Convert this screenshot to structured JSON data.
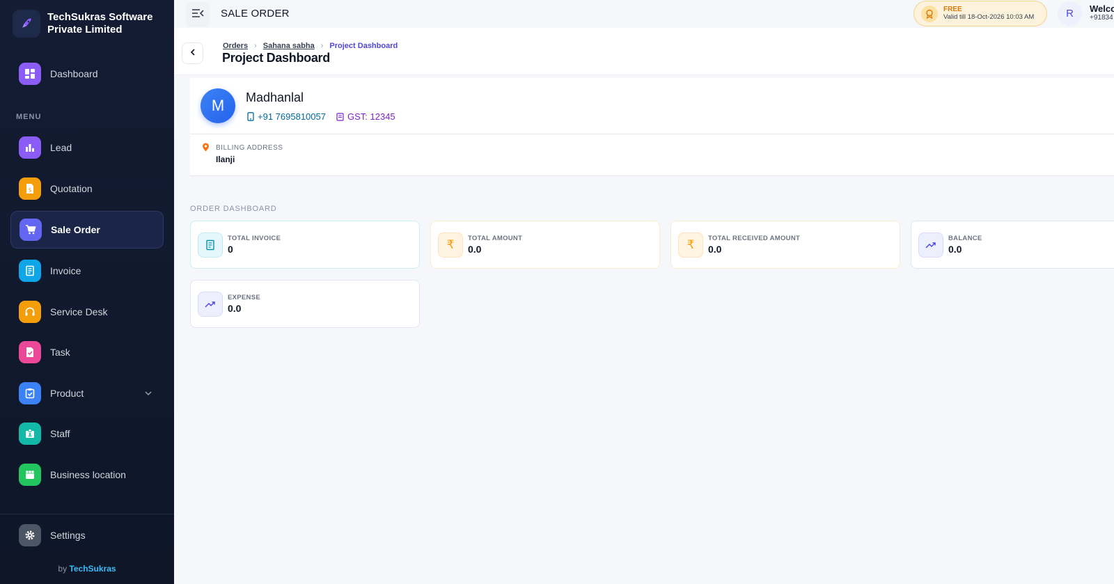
{
  "brand": {
    "name": "TechSukras Software Private Limited"
  },
  "sidebar": {
    "dashboard_label": "Dashboard",
    "menu_caption": "MENU",
    "items": [
      {
        "label": "Lead",
        "icon": "bar-chart-icon",
        "color": "#8b5cf6"
      },
      {
        "label": "Quotation",
        "icon": "quotation-doc-icon",
        "color": "#f59e0b"
      },
      {
        "label": "Sale Order",
        "icon": "cart-icon",
        "color": "#6366f1",
        "active": true
      },
      {
        "label": "Invoice",
        "icon": "receipt-icon",
        "color": "#0ea5e9"
      },
      {
        "label": "Service Desk",
        "icon": "headset-icon",
        "color": "#f59e0b"
      },
      {
        "label": "Task",
        "icon": "task-icon",
        "color": "#ec4899"
      },
      {
        "label": "Product",
        "icon": "clipboard-icon",
        "color": "#3b82f6",
        "has_submenu": true
      },
      {
        "label": "Staff",
        "icon": "id-badge-icon",
        "color": "#14b8a6"
      },
      {
        "label": "Business location",
        "icon": "store-icon",
        "color": "#22c55e"
      }
    ],
    "settings_label": "Settings",
    "byline_prefix": "by",
    "byline_brand": "TechSukras"
  },
  "topbar": {
    "page_heading": "SALE ORDER",
    "plan_title": "FREE",
    "plan_valid": "Valid till 18-Oct-2026 10:03 AM",
    "avatar_letter": "R",
    "welcome_title": "Welco",
    "welcome_sub": "+91834"
  },
  "breadcrumb": {
    "items": [
      "Orders",
      "Sahana sabha"
    ],
    "current": "Project Dashboard"
  },
  "page_title": "Project Dashboard",
  "customer": {
    "initial": "M",
    "name": "Madhanlal",
    "phone": "+91 7695810057",
    "gst": "GST: 12345",
    "address_label": "BILLING ADDRESS",
    "address": "Ilanji"
  },
  "order_dashboard": {
    "caption": "ORDER DASHBOARD",
    "stats": [
      {
        "label": "TOTAL INVOICE",
        "value": "0"
      },
      {
        "label": "TOTAL AMOUNT",
        "value": "0.0"
      },
      {
        "label": "TOTAL RECEIVED AMOUNT",
        "value": "0.0"
      },
      {
        "label": "BALANCE",
        "value": "0.0"
      },
      {
        "label": "EXPENSE",
        "value": "0.0"
      }
    ]
  },
  "colors": {
    "sidebar_bg": "#0f172a",
    "accent": "#4f46e5",
    "plan_bg": "#fdf3dc"
  }
}
